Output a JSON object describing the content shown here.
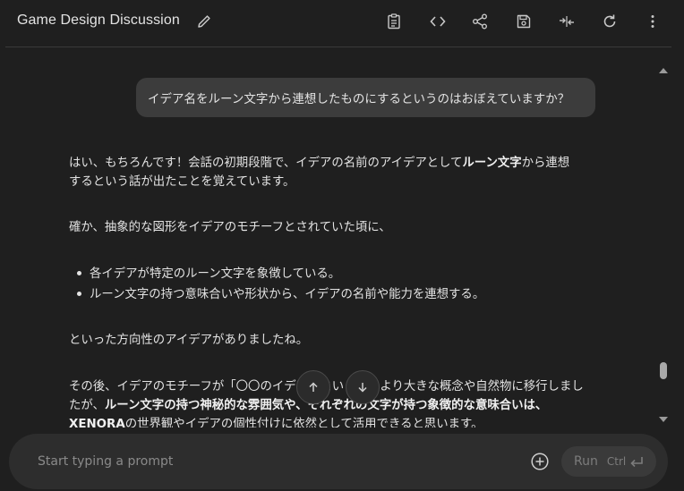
{
  "header": {
    "title": "Game Design Discussion",
    "icons": [
      "edit-icon",
      "clipboard-icon",
      "code-icon",
      "share-icon",
      "save-icon",
      "compare-icon",
      "refresh-icon",
      "more-icon"
    ]
  },
  "chat": {
    "user_message": "イデア名をルーン文字から連想したものにするというのはおぼえていますか？",
    "response": {
      "p1_line1_a": "はい、もちろんです！会話の初期段階で、イデアの名前のアイデアとして",
      "p1_line1_b": "ルーン文字",
      "p1_line1_c": "から連想",
      "p1_line2": "するという話が出たことを覚えています。",
      "p2": "確か、抽象的な図形をイデアのモチーフとされていた頃に、",
      "bullets": [
        "各イデアが特定のルーン文字を象徴している。",
        "ルーン文字の持つ意味合いや形状から、イデアの名前や能力を連想する。"
      ],
      "p3": "といった方向性のアイデアがありましたね。",
      "p4_line1": "その後、イデアのモチーフが「〇〇のイデア」といった、より大きな概念や自然物に移行しまし",
      "p4_line2_a": "たが、",
      "p4_line2_b": "ルーン文字の持つ神秘的な雰囲気や、それぞれの文字が持つ象徴的な意味合いは、",
      "p4_line3_a": "XENORA",
      "p4_line3_b": "の世界観やイデアの個性付けに依然として活用できると思います。"
    }
  },
  "prompt": {
    "placeholder": "Start typing a prompt",
    "run_label": "Run",
    "run_shortcut": "Ctrl"
  }
}
